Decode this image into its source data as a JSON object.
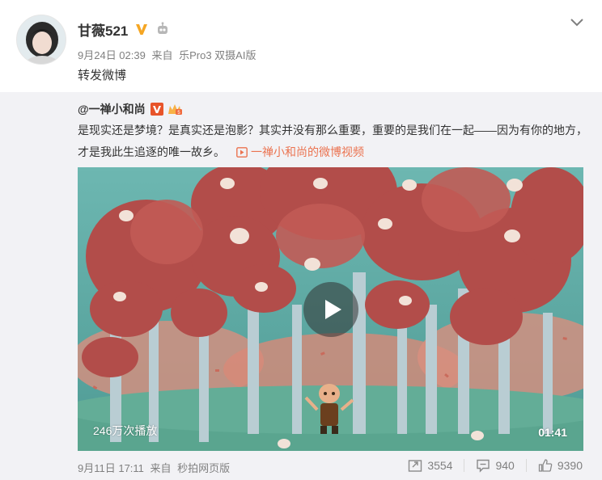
{
  "post": {
    "user_name": "甘薇521",
    "date": "9月24日 02:39",
    "source_prefix": "来自",
    "source": "乐Pro3 双摄AI版",
    "text": "转发微博"
  },
  "retweet": {
    "author": "@一禅小和尚",
    "text": "是现实还是梦境？是真实还是泡影？其实并没有那么重要，重要的是我们在一起——因为有你的地方，才是我此生追逐的唯一故乡。",
    "video_link": "一禅小和尚的微博视频",
    "video": {
      "view_count": "246万次播放",
      "duration": "01:41"
    },
    "date": "9月11日 17:11",
    "source_prefix": "来自",
    "source": "秒拍网页版",
    "actions": {
      "repost_count": "3554",
      "comment_count": "940",
      "like_count": "9390"
    }
  },
  "icons": {
    "menu": "chevron-down-icon",
    "verified": "verified-v-icon",
    "robot": "robot-icon",
    "repost": "repost-icon",
    "comment": "comment-icon",
    "like": "thumbs-up-icon",
    "play": "play-icon"
  },
  "colors": {
    "link": "#eb7350",
    "verified": "#f5a623",
    "retweet_bg": "#f2f2f5",
    "meta_text": "#808080"
  }
}
